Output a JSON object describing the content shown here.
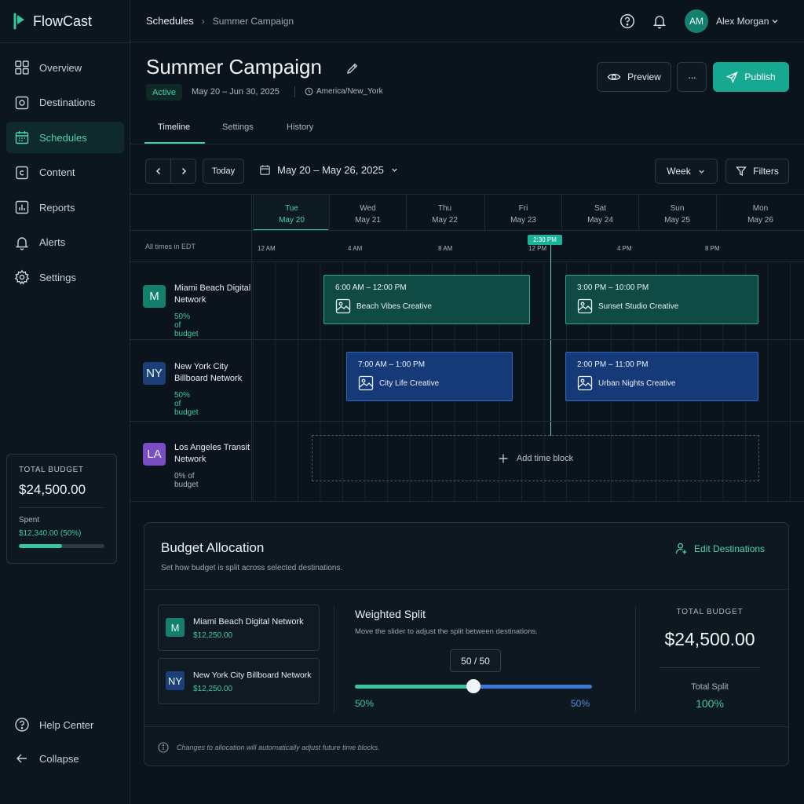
{
  "app": {
    "name": "FlowCast"
  },
  "sidebar": {
    "items": [
      {
        "label": "Overview",
        "icon": "grid-icon"
      },
      {
        "label": "Destinations",
        "icon": "target-icon"
      },
      {
        "label": "Schedules",
        "icon": "calendar-icon",
        "active": true
      },
      {
        "label": "Content",
        "icon": "content-icon"
      },
      {
        "label": "Reports",
        "icon": "reports-icon"
      },
      {
        "label": "Alerts",
        "icon": "bell-icon"
      },
      {
        "label": "Settings",
        "icon": "gear-icon"
      }
    ],
    "budget_card": {
      "label": "TOTAL BUDGET",
      "amount": "$24,500.00",
      "spent_label": "Spent",
      "spent_value": "$12,340.00 (50%)",
      "spent_fraction": 0.5
    },
    "bottom": {
      "help": "Help Center",
      "collapse": "Collapse"
    }
  },
  "topbar": {
    "breadcrumb_root": "Schedules",
    "breadcrumb_sep": "›",
    "breadcrumb_current": "Summer Campaign",
    "user_initials": "AM",
    "user_name": "Alex Morgan"
  },
  "header": {
    "title": "Summer Campaign",
    "status": "Active",
    "dates": "May 20 – Jun 30, 2025",
    "timezone": "America/New_York",
    "preview_label": "Preview",
    "more_label": "···",
    "publish_label": "Publish"
  },
  "tabs": [
    {
      "label": "Timeline",
      "active": true
    },
    {
      "label": "Settings"
    },
    {
      "label": "History"
    }
  ],
  "toolbar": {
    "today_label": "Today",
    "date_range": "May 20 – May 26, 2025",
    "view_label": "Week",
    "filters_label": "Filters"
  },
  "calendar": {
    "tz_note": "All times in EDT",
    "days": [
      {
        "dow": "Tue",
        "date": "May 20",
        "active": true
      },
      {
        "dow": "Wed",
        "date": "May 21"
      },
      {
        "dow": "Thu",
        "date": "May 22"
      },
      {
        "dow": "Fri",
        "date": "May 23"
      },
      {
        "dow": "Sat",
        "date": "May 24"
      },
      {
        "dow": "Sun",
        "date": "May 25"
      },
      {
        "dow": "Mon",
        "date": "May 26"
      }
    ],
    "hours": [
      "12 AM",
      "4 AM",
      "8 AM",
      "12 PM",
      "4 PM",
      "8 PM"
    ],
    "now_label": "2:30 PM",
    "destinations": [
      {
        "badge": "M",
        "name": "Miami Beach Digital Network",
        "share": "50% of budget",
        "color": "#13806d"
      },
      {
        "badge": "NY",
        "name": "New York City Billboard Network",
        "share": "50% of budget",
        "color": "#1d3f77"
      },
      {
        "badge": "LA",
        "name": "Los Angeles Transit Network",
        "share": "0% of budget",
        "color": "#7a4dc4"
      }
    ],
    "blocks": [
      {
        "time": "6:00 AM – 12:00 PM",
        "asset": "Beach Vibes Creative"
      },
      {
        "time": "3:00 PM – 10:00 PM",
        "asset": "Sunset Studio Creative"
      },
      {
        "time": "7:00 AM – 1:00 PM",
        "asset": "City Life Creative"
      },
      {
        "time": "2:00 PM – 11:00 PM",
        "asset": "Urban Nights Creative"
      }
    ],
    "add_block_label": "Add time block"
  },
  "allocation": {
    "title": "Budget Allocation",
    "subtitle": "Set how budget is split across selected destinations.",
    "edit_label": "Edit Destinations",
    "cards": [
      {
        "badge": "M",
        "name": "Miami Beach Digital Network",
        "amount": "$12,250.00",
        "color": "#13806d"
      },
      {
        "badge": "NY",
        "name": "New York City Billboard Network",
        "amount": "$12,250.00",
        "color": "#1d3f77"
      }
    ],
    "weighted_title": "Weighted Split",
    "weighted_sub": "Move the slider to adjust the split between destinations.",
    "slider_value": "50 / 50",
    "slider_fraction": 0.5,
    "left_pct": "50%",
    "right_pct": "50%",
    "total_budget_label": "TOTAL BUDGET",
    "total_budget": "$24,500.00",
    "total_split_label": "Total Split",
    "total_split": "100%",
    "footnote": "Changes to allocation will automatically adjust future time blocks."
  },
  "colors": {
    "accent": "#17a892",
    "teal_block": "#0f4b44",
    "blue_block": "#163a78",
    "background": "#0b141c"
  }
}
